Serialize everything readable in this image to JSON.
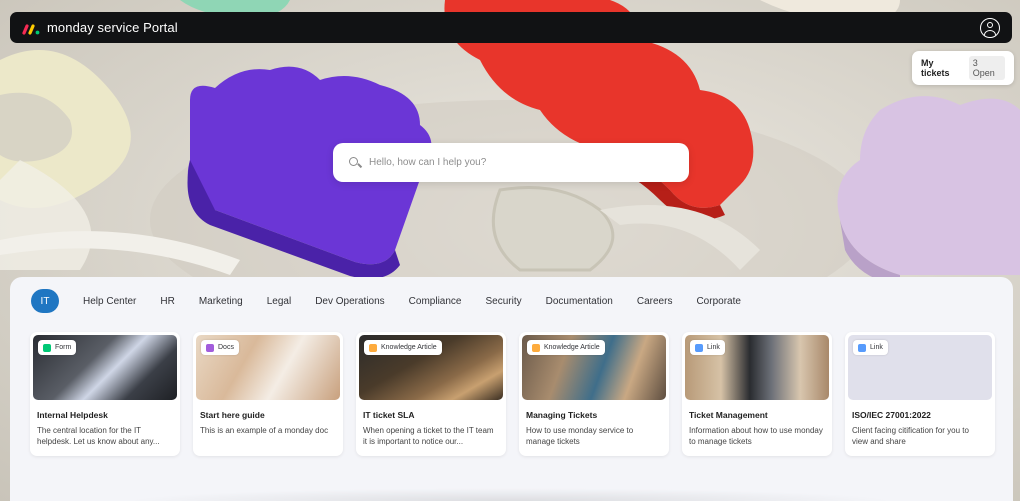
{
  "app": {
    "title": "monday service Portal",
    "brand_colors": [
      "#f62b54",
      "#ffcc00",
      "#00ca72"
    ]
  },
  "header": {
    "logo_icon": "monday-logo-icon",
    "profile_icon": "user-avatar-icon"
  },
  "my_tickets": {
    "label": "My tickets",
    "count": "3 Open"
  },
  "search": {
    "placeholder": "Hello, how can I help you?",
    "icon": "search-icon"
  },
  "tabs": [
    {
      "label": "IT",
      "active": true
    },
    {
      "label": "Help Center"
    },
    {
      "label": "HR"
    },
    {
      "label": "Marketing"
    },
    {
      "label": "Legal"
    },
    {
      "label": "Dev Operations"
    },
    {
      "label": "Compliance"
    },
    {
      "label": "Security"
    },
    {
      "label": "Documentation"
    },
    {
      "label": "Careers"
    },
    {
      "label": "Corporate"
    }
  ],
  "cards": [
    {
      "badge": "Form",
      "badge_icon": "form-icon",
      "badge_color": "#00c875",
      "title": "Internal Helpdesk",
      "desc": "The central location for the IT helpdesk. Let us know about any..."
    },
    {
      "badge": "Docs",
      "badge_icon": "docs-icon",
      "badge_color": "#a25ddc",
      "title": "Start here guide",
      "desc": "This is an example of a monday doc"
    },
    {
      "badge": "Knowledge Article",
      "badge_icon": "article-icon",
      "badge_color": "#fdab3d",
      "title": "IT ticket SLA",
      "desc": "When opening a ticket to the IT team it is important to notice our..."
    },
    {
      "badge": "Knowledge Article",
      "badge_icon": "article-icon",
      "badge_color": "#fdab3d",
      "title": "Managing Tickets",
      "desc": "How to use monday service to manage tickets"
    },
    {
      "badge": "Link",
      "badge_icon": "link-icon",
      "badge_color": "#579bfc",
      "title": "Ticket Management",
      "desc": "Information about how to use monday to manage tickets"
    },
    {
      "badge": "Link",
      "badge_icon": "link-icon",
      "badge_color": "#579bfc",
      "title": "ISO/IEC 27001:2022",
      "desc": "Client facing citification for you to view and share"
    }
  ],
  "active_tab_color": "#1f76c2"
}
